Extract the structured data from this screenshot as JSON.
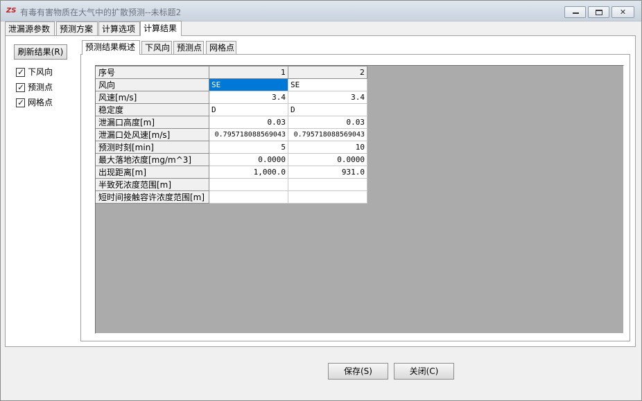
{
  "window": {
    "title": "有毒有害物质在大气中的扩散预测--未标题2",
    "icon_text": "ZS",
    "controls": {
      "minimize": "—",
      "maximize": "□",
      "close": "✕"
    }
  },
  "outer_tabs": [
    {
      "label": "泄漏源参数",
      "active": false
    },
    {
      "label": "预测方案",
      "active": false
    },
    {
      "label": "计算选项",
      "active": false
    },
    {
      "label": "计算结果",
      "active": true
    }
  ],
  "left_panel": {
    "refresh_label": "刷新结果(R)",
    "checkboxes": [
      {
        "label": "下风向",
        "checked": true
      },
      {
        "label": "预测点",
        "checked": true
      },
      {
        "label": "网格点",
        "checked": true
      }
    ]
  },
  "inner_tabs": [
    {
      "label": "预测结果概述",
      "active": true
    },
    {
      "label": "下风向",
      "active": false
    },
    {
      "label": "预测点",
      "active": false
    },
    {
      "label": "网格点",
      "active": false
    }
  ],
  "table": {
    "header": {
      "label": "序号",
      "col1": "1",
      "col2": "2"
    },
    "rows": [
      {
        "label": "风向",
        "col1": "SE",
        "col2": "SE"
      },
      {
        "label": "风速[m/s]",
        "col1": "3.4",
        "col2": "3.4"
      },
      {
        "label": "稳定度",
        "col1": "D",
        "col2": "D"
      },
      {
        "label": "泄漏口高度[m]",
        "col1": "0.03",
        "col2": "0.03"
      },
      {
        "label": "泄漏口处风速[m/s]",
        "col1": "0.795718088569043",
        "col2": "0.795718088569043"
      },
      {
        "label": "预测时刻[min]",
        "col1": "5",
        "col2": "10"
      },
      {
        "label": "最大落地浓度[mg/m^3]",
        "col1": "0.0000",
        "col2": "0.0000"
      },
      {
        "label": "出现距离[m]",
        "col1": "1,000.0",
        "col2": "931.0"
      },
      {
        "label": "半致死浓度范围[m]",
        "col1": "",
        "col2": ""
      },
      {
        "label": "短时间接触容许浓度范围[m]",
        "col1": "",
        "col2": ""
      }
    ]
  },
  "buttons": {
    "save": "保存(S)",
    "close": "关闭(C)"
  },
  "colors": {
    "selection": "#0078d7",
    "grid_bg": "#ababab"
  }
}
